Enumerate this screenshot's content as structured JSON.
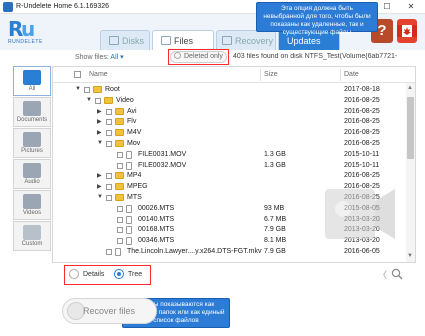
{
  "window": {
    "title": "R-Undelete Home 6.1.169326",
    "minimize": "—",
    "maximize": "☐",
    "close": "✕"
  },
  "logo": {
    "text": "RUNDELETE"
  },
  "tabs": [
    {
      "label": "Disks"
    },
    {
      "label": "Files"
    },
    {
      "label": "Recovery"
    },
    {
      "label": "Updates"
    }
  ],
  "tooltip_top": "Эта опция должна быть невыбранной для того, чтобы были показаны как удаленные, так и существующие файлы",
  "tooltip_bottom": "Файлы показываются как структура папок или как единый список файлов",
  "toolbar": {
    "show_files_label": "Show files:",
    "show_files_value": "All",
    "deleted_only_label": "Deleted only",
    "found_info": "403 files found on disk NTFS_Test(Volume{6ab7721-"
  },
  "sidebar": [
    {
      "label": "All",
      "color": "#2a7fd4"
    },
    {
      "label": "Documents",
      "color": "#7f8ea0"
    },
    {
      "label": "Pictures",
      "color": "#7f8ea0"
    },
    {
      "label": "Audio",
      "color": "#7f8ea0"
    },
    {
      "label": "Videos",
      "color": "#7f8ea0"
    },
    {
      "label": "Custom",
      "color": "#7f8ea0"
    }
  ],
  "columns": {
    "name": "Name",
    "size": "Size",
    "date": "Date"
  },
  "rows": [
    {
      "arrow": "▼",
      "type": "folder",
      "name": "Root",
      "size": "",
      "date": "2017-08-18",
      "indent": 0
    },
    {
      "arrow": "▼",
      "type": "folder",
      "name": "Video",
      "size": "",
      "date": "2016-08-25",
      "indent": 1
    },
    {
      "arrow": "▶",
      "type": "folder",
      "name": "Avi",
      "size": "",
      "date": "2016-08-25",
      "indent": 2
    },
    {
      "arrow": "▶",
      "type": "folder",
      "name": "Flv",
      "size": "",
      "date": "2016-08-25",
      "indent": 2
    },
    {
      "arrow": "▶",
      "type": "folder",
      "name": "M4V",
      "size": "",
      "date": "2016-08-25",
      "indent": 2
    },
    {
      "arrow": "▼",
      "type": "folder",
      "name": "Mov",
      "size": "",
      "date": "2016-08-25",
      "indent": 2
    },
    {
      "arrow": "",
      "type": "file",
      "name": "FILE0031.MOV",
      "size": "1.3 GB",
      "date": "2015-10-11",
      "indent": 3
    },
    {
      "arrow": "",
      "type": "file",
      "name": "FILE0032.MOV",
      "size": "1.3 GB",
      "date": "2015-10-11",
      "indent": 3
    },
    {
      "arrow": "▶",
      "type": "folder",
      "name": "MP4",
      "size": "",
      "date": "2016-08-25",
      "indent": 2
    },
    {
      "arrow": "▶",
      "type": "folder",
      "name": "MPEG",
      "size": "",
      "date": "2016-08-25",
      "indent": 2
    },
    {
      "arrow": "▼",
      "type": "folder",
      "name": "MTS",
      "size": "",
      "date": "2016-08-25",
      "indent": 2
    },
    {
      "arrow": "",
      "type": "file",
      "name": "00026.MTS",
      "size": "93 MB",
      "date": "2015-08-05",
      "indent": 3
    },
    {
      "arrow": "",
      "type": "file",
      "name": "00140.MTS",
      "size": "6.7 MB",
      "date": "2013-03-20",
      "indent": 3
    },
    {
      "arrow": "",
      "type": "file",
      "name": "00168.MTS",
      "size": "7.9 GB",
      "date": "2013-03-20",
      "indent": 3
    },
    {
      "arrow": "",
      "type": "file",
      "name": "00346.MTS",
      "size": "8.1 MB",
      "date": "2013-03-20",
      "indent": 3
    },
    {
      "arrow": "",
      "type": "file",
      "name": "The.Lincoln.Lawyer....y.x264.DTS-FGT.mkv",
      "size": "7.9 GB",
      "date": "2016-06-05",
      "indent": 2
    }
  ],
  "view": {
    "details_label": "Details",
    "tree_label": "Tree",
    "selected": "Tree"
  },
  "nav_prev": "〈",
  "recover": {
    "label": "Recover files"
  },
  "colors": {
    "accent": "#2a7fd4",
    "highlight": "#ff2a2a",
    "tooltip": "#2c7bd6"
  }
}
